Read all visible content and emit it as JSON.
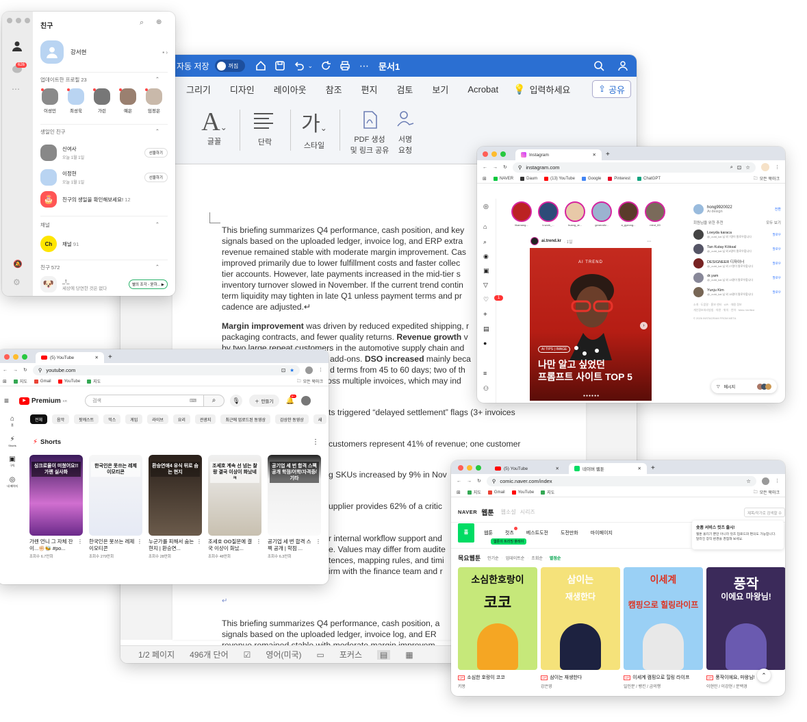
{
  "word": {
    "autosave": "자동 저장",
    "toggle": "꺼짐",
    "doc_title": "문서1",
    "tabs": [
      "그리기",
      "디자인",
      "레이아웃",
      "참조",
      "편지",
      "검토",
      "보기",
      "Acrobat"
    ],
    "tell_me": "입력하세요",
    "share": "공유",
    "ribbon": {
      "font": "글꼴",
      "paragraph": "단락",
      "style": "스타일",
      "pdf_1": "PDF 생성",
      "pdf_2": "및 링크 공유",
      "sign_1": "서명",
      "sign_2": "요청"
    },
    "p1": [
      "This briefing summarizes Q4 performance, cash position, and key",
      "signals based on the uploaded ledger, invoice log, and ERP extra",
      "revenue remained stable with moderate margin improvement. Cas",
      "improved primarily due to lower fulfillment costs and faster collec",
      "tier accounts. However, late payments increased in the mid-tier s",
      "inventory turnover slowed in November. If the current trend contin",
      "term liquidity may tighten in late Q1 unless payment terms and pr",
      "cadence are adjusted.↵"
    ],
    "p2_b1": "Margin improvement",
    "p2_t1": " was driven by reduced expedited shipping, r",
    "p2_l2a": "packaging contracts, and fewer quality returns. ",
    "p2_b2": "Revenue growth",
    "p2_l2b": " v",
    "p2_l3": "by two large repeat customers in the automotive supply chain and",
    "p2_l4a": "add-ons. ",
    "p2_b3": "DSO increased",
    "p2_l4b": " mainly beca",
    "p2_l5": "d terms from 45 to 60 days; two of th",
    "p2_l6": "ross multiple invoices, which may ind",
    "f1": "ts triggered “delayed settlement” flags (3+ invoices",
    "f2": "customers represent 41% of revenue; one customer",
    "f3": "g SKUs increased by 9% in Nov",
    "f4": "upplier provides 62% of a critic",
    "f5": [
      "r internal workflow support and",
      "e. Values may differ from audite",
      "tences, mapping rules, and timi",
      "irm with the finance team and r"
    ],
    "ret": "↵",
    "p3": [
      "This briefing summarizes Q4 performance, cash position, a",
      "signals based on the uploaded ledger, invoice log, and ER",
      "revenue remained stable with moderate margin improvem"
    ],
    "status": {
      "page": "1/2 페이지",
      "words": "496개 단어",
      "lang": "영어(미국)",
      "focus": "포커스"
    }
  },
  "kakao": {
    "title": "친구",
    "badge": "626",
    "me": "강서현",
    "updated": "업데이트한 프로필",
    "updated_count": "23",
    "profiles": [
      "이성민",
      "최성욱",
      "가린",
      "예은",
      "임정은"
    ],
    "birthday": "생일인 친구",
    "bdays": [
      {
        "name": "신여사",
        "date": "오늘 1월 1일",
        "btn": "선물하기"
      },
      {
        "name": "이정현",
        "date": "오늘 1월 1일",
        "btn": "선물하기"
      }
    ],
    "check_bday": "친구의 생일을 확인해보세요!",
    "check_count": "12",
    "channel": "채널",
    "channel_item": "채널",
    "channel_count": "91",
    "friends": "친구 572",
    "friend_name": "_!_",
    "friend_status": "세상에 당연한 것은 없다",
    "friend_music": "별의 조각 - 윤하..."
  },
  "instagram": {
    "tab": "Instagram",
    "url": "instagram.com",
    "bookmarks": [
      "NAVER",
      "Daum",
      "(13) YouTube",
      "Google",
      "Pinterest",
      "ChatGPT"
    ],
    "all_bm": "모든 북마크",
    "stories": [
      "likamang...",
      "k.work_...",
      "huang_ar...",
      "generativ...",
      "a_gyeong...",
      "mind_83"
    ],
    "post_user": "ai.trend.kr",
    "post_time": "· 1일",
    "post_overline": "AI TREND",
    "post_tag": "AI TIPS | IMAGE",
    "post_line1": "나만 알고 싶었던",
    "post_line2": "프롬프트 사이트 TOP 5",
    "notif": "1",
    "me_user": "hong9920022",
    "me_sub": "Ai design",
    "switch": "전환",
    "suggest": "회원님을 위한 추천",
    "see_all": "모두 보기",
    "sugs": [
      {
        "name": "Loeyda karaca",
        "sub": "@_outd_kai 님 외 7명이 팔로우합니다"
      },
      {
        "name": "Tan Kutay Köksal",
        "sub": "@_outd_kai 님 외 8명이 팔로우합니다"
      },
      {
        "name": "DESIGNEER 디자이너",
        "sub": "@_outd_kai 님 외 27명이 팔로우합니다"
      },
      {
        "name": "dr.yam",
        "sub": "@_outd_kai 님 외 13명이 팔로우합니다"
      },
      {
        "name": "Yunju Kim",
        "sub": "@_outd_kai 님 외 15명이 팔로우합니다"
      }
    ],
    "follow": "팔로우",
    "footer1": "소개 · 도움말 · 홍보 센터 · API · 채용 정보",
    "footer2": "개인정보처리방침 · 약관 · 위치 · 언어 · Meta Verified",
    "footer3": "© 2026 INSTAGRAM FROM META",
    "dm": "메시지"
  },
  "youtube": {
    "tab": "(5) YouTube",
    "url": "youtube.com",
    "bookmarks": [
      "지도",
      "Gmail",
      "YouTube",
      "지도"
    ],
    "all_bm": "모든 북마크",
    "logo": "Premium",
    "kr": "KR",
    "search": "검색",
    "create": "만들기",
    "notif": "9+",
    "chips": [
      "전체",
      "음악",
      "팟캐스트",
      "믹스",
      "게임",
      "라이브",
      "요리",
      "관광지",
      "최근에 업로드된 동영상",
      "감상한 동영상",
      "새"
    ],
    "side": [
      "홈",
      "Shorts",
      "구독",
      "내 페이지"
    ],
    "shorts": "Shorts",
    "items": [
      {
        "th": "싱크로율이 미쳤어요!! 가렌 실사화",
        "title": "가렌 언니 그 자체 잔이...✊🏻🐝 #po...",
        "views": "조회수 6.7만회"
      },
      {
        "th": "한국인은 못쓰는 레제 이모티콘",
        "title": "한국인은 못쓰는 레제 이모티콘",
        "views": "조회수 279만회"
      },
      {
        "th": "환승연애4 유식 뒤로 숨는 현지",
        "title": "누군가를 피해서 숨는 현지 | 환승연...",
        "views": "조회수 28만회"
      },
      {
        "th": "조세호 계속 선 넘는 찰랑 결국 이상이 화났네ㅋ",
        "title": "조세호 OO질문에 결국 이상이 화났...",
        "views": "조회수 48만회"
      },
      {
        "th": "공기업 세 번 합격 스펙 공개 학점/어학/자격증/기타",
        "title": "공기업 세 번 합격 스펙 공개 | 학점 ...",
        "views": "조회수 6.3만회"
      }
    ]
  },
  "webtoon": {
    "tab1": "(5) YouTube",
    "tab2": "네이버 웹툰",
    "url": "comic.naver.com/index",
    "bookmarks": [
      "지도",
      "Gmail",
      "YouTube",
      "지도"
    ],
    "all_bm": "모든 북마크",
    "naver": "NAVER",
    "webtoon": "웹툰",
    "nav2": "웹소설",
    "nav3": "시리즈",
    "search": "제목/작가로 검색할 수",
    "home": "홈",
    "tabs": [
      "웹툰",
      "컷츠",
      "베스트도전",
      "도전만화",
      "마이페이지"
    ],
    "cuts_tip": "웹툰의 트리밍 플레이",
    "notice_title": "숏폼 서비스 컷츠 출시!",
    "notice_body": "웹툰 올리기 뿐만 아니라 컷츠 업로드와 편의도 가능합니다. 달라진 창작 환경을 경험해 보세요.",
    "day_label": "목요웹툰",
    "sort": [
      "인기순",
      "업데이트순",
      "조회순",
      "별점순"
    ],
    "cards": [
      {
        "title": "소심한 호랑이 코코",
        "author": "키몽",
        "c1": "소심한호랑이",
        "c2": "코코"
      },
      {
        "title": "삼이는 재생한다",
        "author": "강은영",
        "c1": "삼이는",
        "c2": "재생한다"
      },
      {
        "title": "이세계 캠핑으로 힐링 라이프",
        "author": "일인분 / 뱅킨 / 금의행",
        "c1": "이세계",
        "c2": "캠핑으로 힐링라이프"
      },
      {
        "title": "풍작이에요, 마왕님!",
        "author": "이현민 / 이강현 / 문백경",
        "c1": "풍작",
        "c2": "이에요 마왕님!"
      }
    ],
    "up": "UP"
  }
}
